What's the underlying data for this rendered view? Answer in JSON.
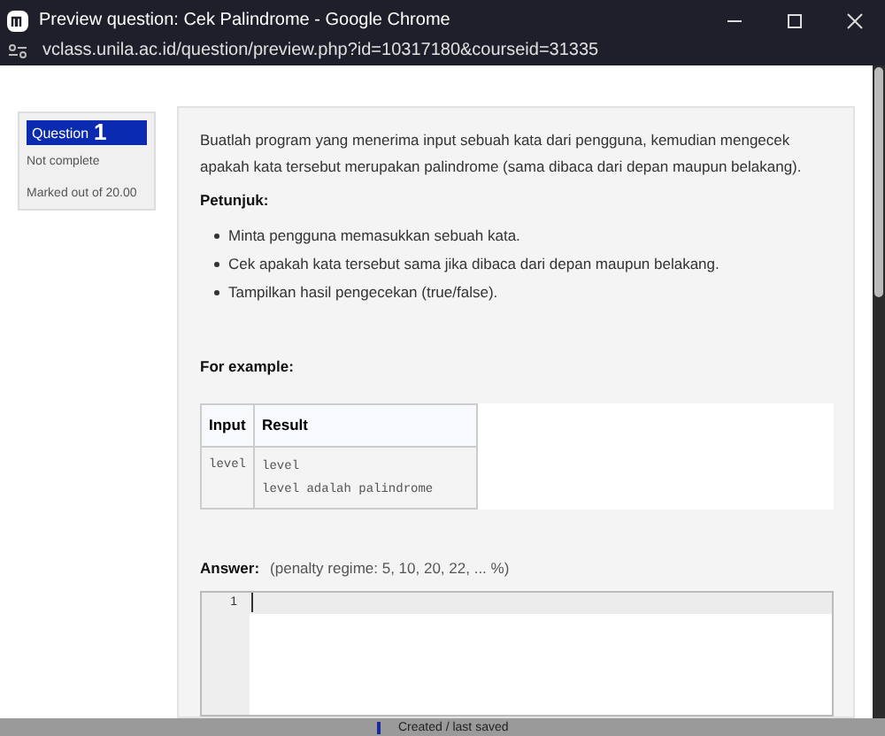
{
  "window": {
    "title": "Preview question: Cek Palindrome - Google Chrome"
  },
  "address_bar": {
    "url": "vclass.unila.ac.id/question/preview.php?id=10317180&courseid=31335"
  },
  "question_info": {
    "label": "Question",
    "number": "1",
    "status": "Not complete",
    "marks": "Marked out of 20.00"
  },
  "question": {
    "intro": "Buatlah program yang menerima input sebuah kata dari pengguna, kemudian mengecek apakah kata tersebut merupakan palindrome (sama dibaca dari depan maupun belakang).",
    "hints_heading": "Petunjuk:",
    "hints": [
      "Minta pengguna memasukkan sebuah kata.",
      "Cek apakah kata tersebut sama jika dibaca dari depan maupun belakang.",
      "Tampilkan hasil pengecekan (true/false)."
    ],
    "example_heading": "For example:",
    "example_table": {
      "columns": [
        "Input",
        "Result"
      ],
      "rows": [
        {
          "input": "level",
          "result": [
            "level",
            "level adalah palindrome"
          ]
        }
      ]
    },
    "answer_label": "Answer:",
    "penalty": "(penalty regime: 5, 10, 20, 22, ... %)",
    "editor": {
      "line_numbers": [
        "1"
      ]
    }
  },
  "status_bar": {
    "text": "Created / last saved"
  }
}
